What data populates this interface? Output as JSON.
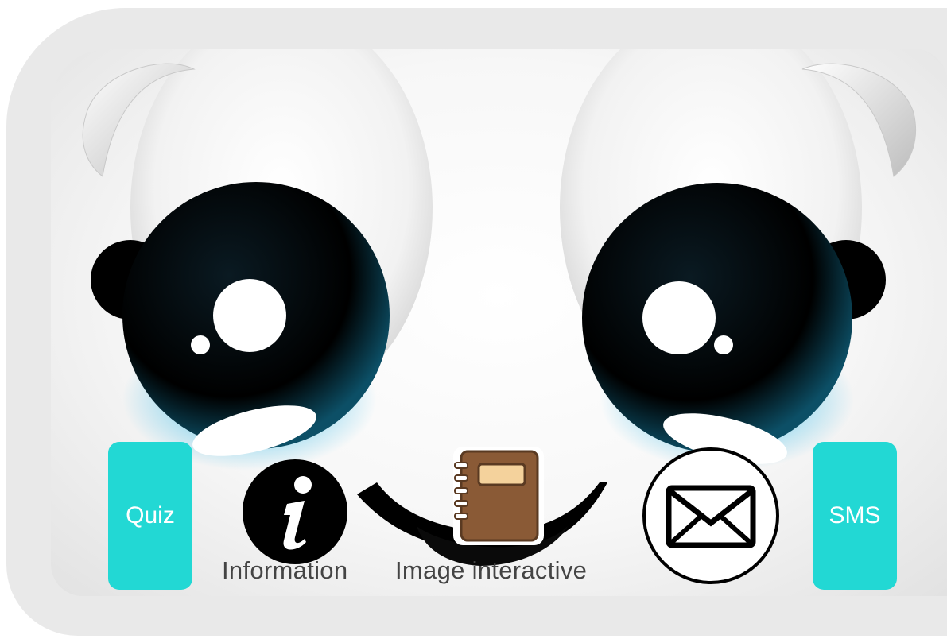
{
  "buttons": {
    "quiz_label": "Quiz",
    "sms_label": "SMS"
  },
  "menu": {
    "information_label": "Information",
    "image_interactive_label": "Image interactive"
  },
  "icons": {
    "information": "information-icon",
    "image_interactive": "notebook-icon",
    "sms_mail": "envelope-icon"
  },
  "colors": {
    "accent": "#22d8d4",
    "frame": "#e9e9e9",
    "eye": "#000000",
    "eye_glow": "#1aa8d8"
  }
}
